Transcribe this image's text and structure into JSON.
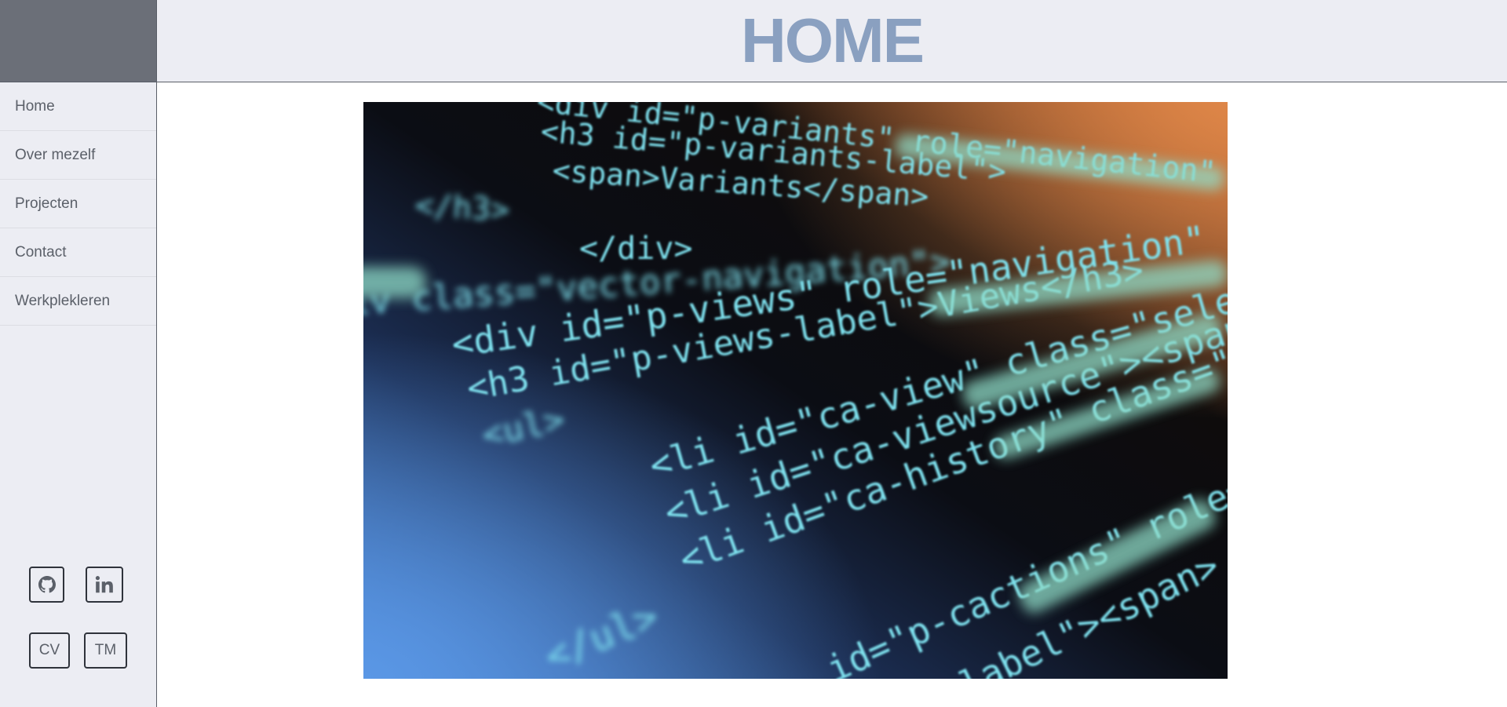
{
  "header": {
    "title": "HOME"
  },
  "sidebar": {
    "items": [
      {
        "label": "Home"
      },
      {
        "label": "Over mezelf"
      },
      {
        "label": "Projecten"
      },
      {
        "label": "Contact"
      },
      {
        "label": "Werkplekleren"
      }
    ],
    "social": [
      {
        "icon": "github-icon"
      },
      {
        "icon": "linkedin-icon"
      }
    ],
    "links": [
      {
        "label": "CV"
      },
      {
        "label": "TM"
      }
    ]
  },
  "hero": {
    "code_lines": [
      "<div id=\"p-variants\" role=\"navigation\"",
      "<h3 id=\"p-variants-label\">",
      "<span>Variants</span>",
      "</h3>",
      "</div>",
      "<div class=\"vector-navigation\">",
      "<div id=\"p-views\" role=\"navigation\"",
      "<h3 id=\"p-views-label\">Views</h3>",
      "<ul>",
      "<li id=\"ca-view\" class=\"selected\"",
      "<li id=\"ca-viewsource\"><span>",
      "<li id=\"ca-history\" class=\"collapsible\"",
      "</ul>",
      "id=\"p-cactions\" role=\"navigation\"",
      "label\"><span>"
    ]
  }
}
